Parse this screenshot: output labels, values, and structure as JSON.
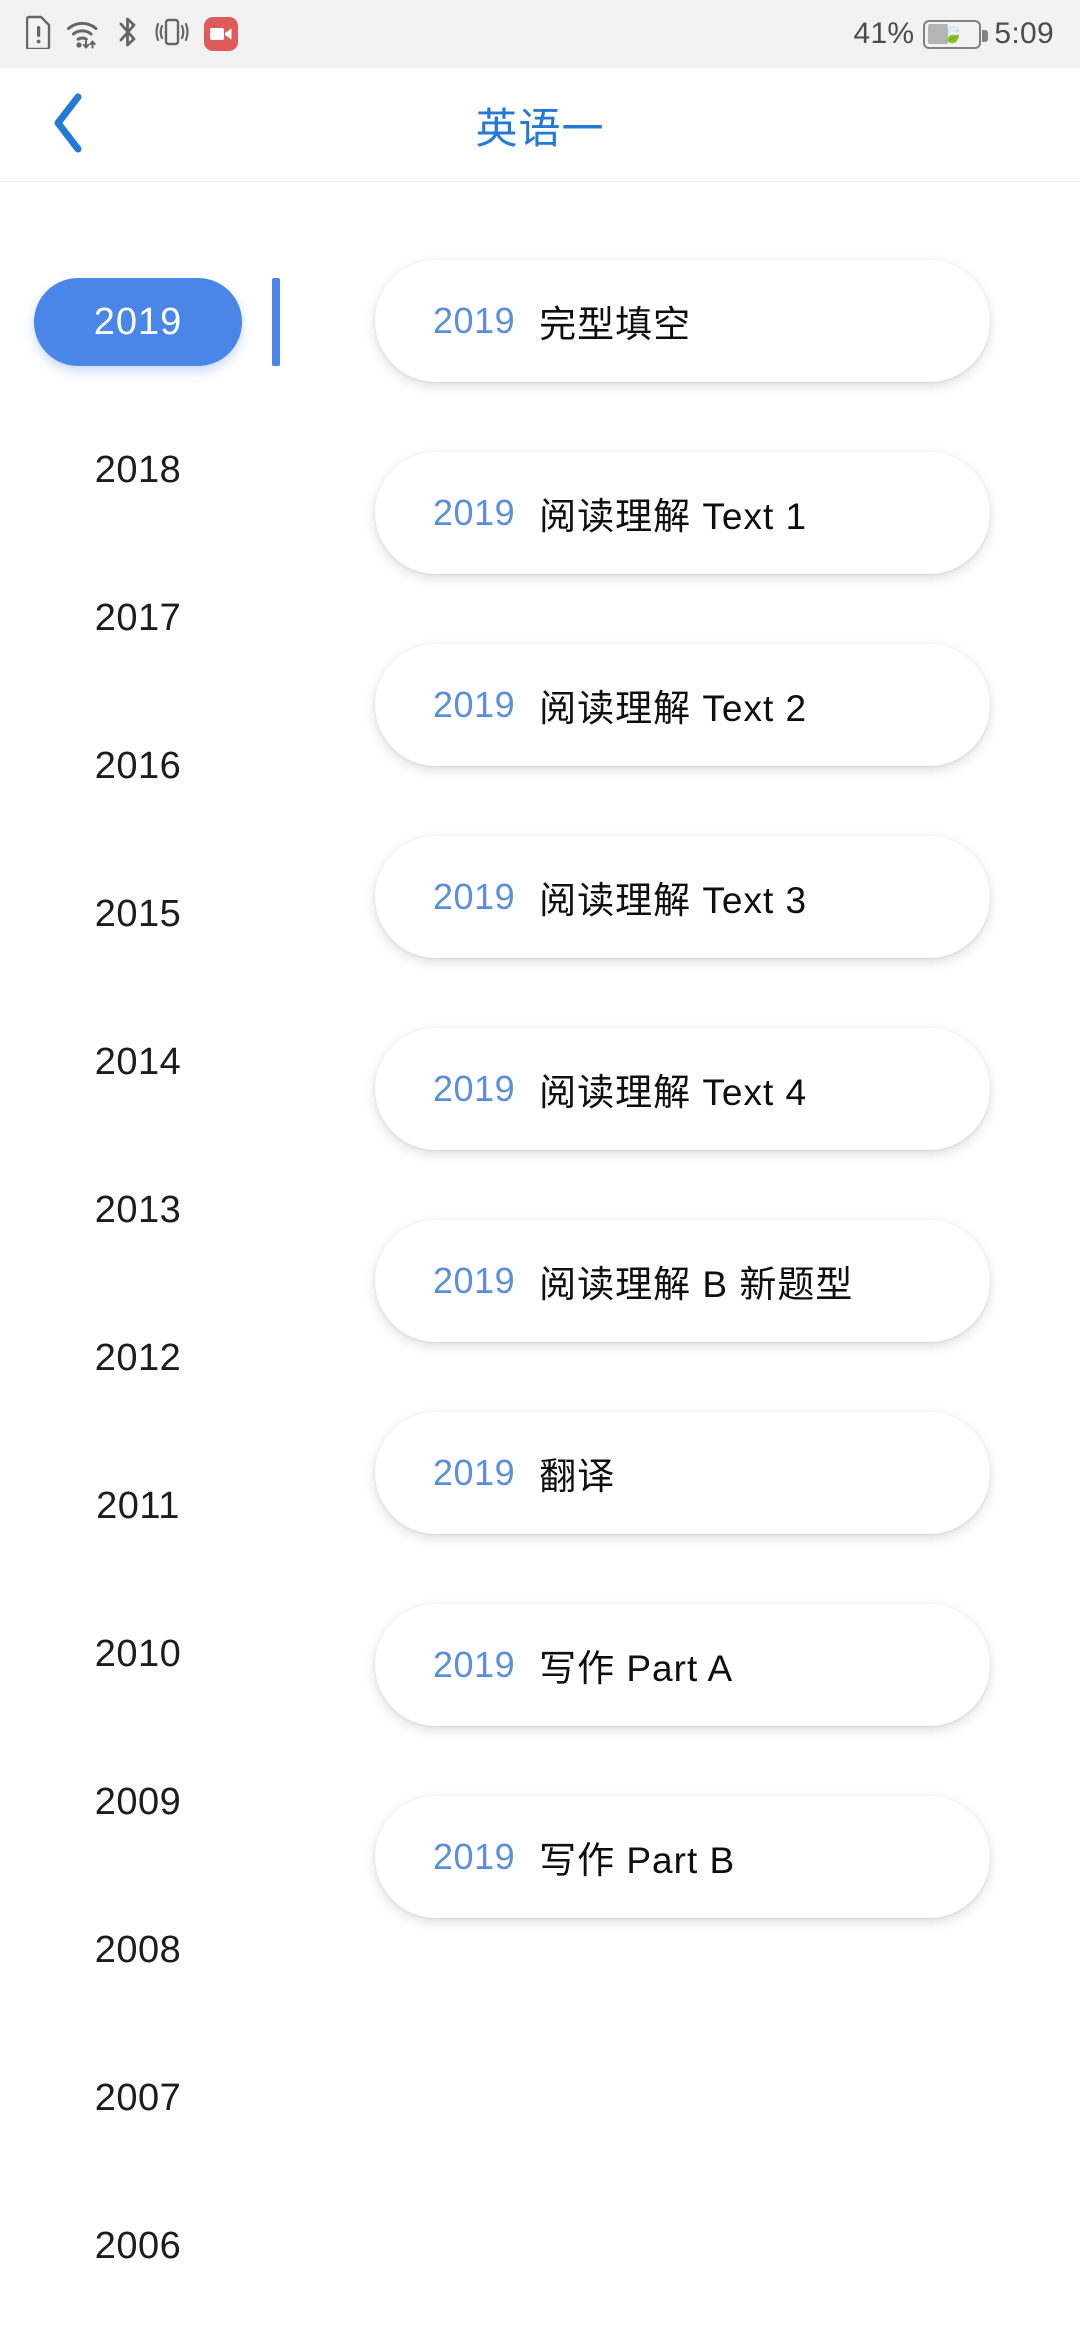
{
  "status_bar": {
    "icons": [
      {
        "name": "sim-card-alert-icon",
        "glyph": "sim-alert"
      },
      {
        "name": "wifi-icon",
        "glyph": "wifi"
      },
      {
        "name": "bluetooth-icon",
        "glyph": "bluetooth"
      },
      {
        "name": "vibrate-mode-icon",
        "glyph": "vibrate"
      },
      {
        "name": "screen-recording-icon",
        "glyph": "record"
      }
    ],
    "battery_percent": "41%",
    "battery_level": 41,
    "battery_saver": "leaf",
    "clock": "5:09"
  },
  "header": {
    "back_label": "<",
    "title": "英语一"
  },
  "colors": {
    "accent_blue": "#4a86e8",
    "title_blue": "#2378d8",
    "card_year_blue": "#5b8fd9",
    "status_bar_bg": "#f2f2f2",
    "record_red": "#dd5b5b"
  },
  "year_rail": {
    "selected": "2019",
    "years": [
      {
        "label": "2019",
        "selected": true
      },
      {
        "label": "2018",
        "selected": false
      },
      {
        "label": "2017",
        "selected": false
      },
      {
        "label": "2016",
        "selected": false
      },
      {
        "label": "2015",
        "selected": false
      },
      {
        "label": "2014",
        "selected": false
      },
      {
        "label": "2013",
        "selected": false
      },
      {
        "label": "2012",
        "selected": false
      },
      {
        "label": "2011",
        "selected": false
      },
      {
        "label": "2010",
        "selected": false
      },
      {
        "label": "2009",
        "selected": false
      },
      {
        "label": "2008",
        "selected": false
      },
      {
        "label": "2007",
        "selected": false
      },
      {
        "label": "2006",
        "selected": false
      }
    ]
  },
  "card_list": {
    "cards": [
      {
        "year": "2019",
        "title": "完型填空"
      },
      {
        "year": "2019",
        "title": "阅读理解 Text 1"
      },
      {
        "year": "2019",
        "title": "阅读理解 Text 2"
      },
      {
        "year": "2019",
        "title": "阅读理解 Text 3"
      },
      {
        "year": "2019",
        "title": "阅读理解 Text 4"
      },
      {
        "year": "2019",
        "title": "阅读理解 B 新题型"
      },
      {
        "year": "2019",
        "title": "翻译"
      },
      {
        "year": "2019",
        "title": "写作 Part A"
      },
      {
        "year": "2019",
        "title": "写作 Part B"
      }
    ]
  }
}
